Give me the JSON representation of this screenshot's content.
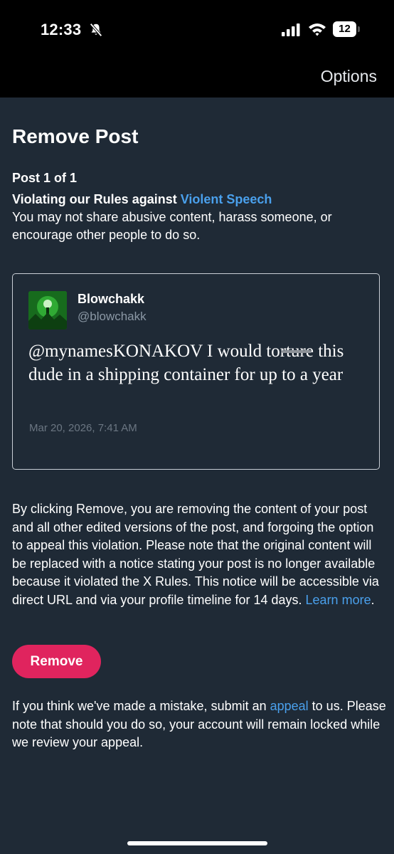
{
  "status_bar": {
    "time": "12:33",
    "battery": "12",
    "icons": [
      "bell-slash-icon",
      "signal-icon",
      "wifi-icon",
      "battery-icon"
    ]
  },
  "header": {
    "options_label": "Options"
  },
  "page": {
    "title": "Remove Post",
    "post_count": "Post 1 of 1",
    "rule_prefix": "Violating our Rules against ",
    "rule_link": "Violent Speech",
    "rule_description": "You may not share abusive content, harass someone, or encourage other people to do so."
  },
  "post": {
    "author_name": "Blowchakk",
    "author_handle": "@blowchakk",
    "text": "@mynamesKONAKOV I would torture this dude in a shipping container for up to a year",
    "timestamp": "Mar 20, 2026, 7:41 AM"
  },
  "notice": {
    "text": "By clicking Remove, you are removing the content of your post and all other edited versions of the post, and forgoing the option to appeal this violation. Please note that the original content will be replaced with a notice stating your post is no longer available because it violated the X Rules. This notice will be accessible via direct URL and via your profile timeline for 14 days. ",
    "learn_more": "Learn more",
    "period": "."
  },
  "actions": {
    "remove_label": "Remove"
  },
  "appeal": {
    "prefix": "If you think we've made a mistake, submit an ",
    "link": "appeal",
    "suffix": " to us. Please note that should you do so, your account will remain locked while we review your appeal."
  },
  "colors": {
    "background": "#1f2a36",
    "accent_link": "#4aa0ec",
    "remove_button": "#e0245e"
  }
}
